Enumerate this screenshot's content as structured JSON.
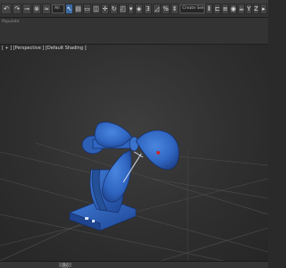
{
  "toolbar": {
    "buttons": [
      {
        "name": "undo-icon",
        "glyph": "↶"
      },
      {
        "name": "redo-icon",
        "glyph": "↷"
      },
      {
        "name": "link-icon",
        "glyph": "⊸"
      },
      {
        "name": "unlink-icon",
        "glyph": "⊗"
      },
      {
        "name": "bind-icon",
        "glyph": "≈"
      },
      {
        "name": "select-filter-icon",
        "glyph": "All"
      },
      {
        "name": "select-object-icon",
        "glyph": "↖"
      },
      {
        "name": "select-by-name-icon",
        "glyph": "▤"
      },
      {
        "name": "rect-region-icon",
        "glyph": "▭"
      },
      {
        "name": "window-crossing-icon",
        "glyph": "◫"
      },
      {
        "name": "move-icon",
        "glyph": "✛"
      },
      {
        "name": "rotate-icon",
        "glyph": "↻"
      },
      {
        "name": "scale-icon",
        "glyph": "◰"
      },
      {
        "name": "ref-coord-icon",
        "glyph": "▾"
      },
      {
        "name": "pivot-icon",
        "glyph": "◈"
      },
      {
        "name": "snap-3d-icon",
        "glyph": "3"
      },
      {
        "name": "angle-snap-icon",
        "glyph": "◿"
      },
      {
        "name": "percent-snap-icon",
        "glyph": "%"
      },
      {
        "name": "spinner-snap-icon",
        "glyph": "⇕"
      },
      {
        "name": "named-sets-icon",
        "glyph": "{}"
      },
      {
        "name": "mirror-icon",
        "glyph": "⫴"
      },
      {
        "name": "align-icon",
        "glyph": "⊏"
      },
      {
        "name": "layers-icon",
        "glyph": "≡"
      },
      {
        "name": "scene-explorer-icon",
        "glyph": "▦"
      },
      {
        "name": "curve-editor-icon",
        "glyph": "∿"
      },
      {
        "name": "schematic-icon",
        "glyph": "⧉"
      },
      {
        "name": "material-editor-icon",
        "glyph": "◉"
      },
      {
        "name": "render-setup-icon",
        "glyph": "⚙"
      },
      {
        "name": "render-frame-icon",
        "glyph": "▣"
      },
      {
        "name": "render-icon",
        "glyph": "☕"
      },
      {
        "name": "axis-y-icon",
        "glyph": "Y"
      },
      {
        "name": "axis-z-icon",
        "glyph": "Z"
      },
      {
        "name": "axis-xy-icon",
        "glyph": "≚"
      },
      {
        "name": "scroll-arrow-icon",
        "glyph": "▸"
      }
    ],
    "dropdown_label": "Create Selection Set",
    "selection_filter": "All"
  },
  "subbar": {
    "label": "Populate"
  },
  "viewport": {
    "label": "[ + ] [Perspective ] [Default Shading ]"
  },
  "timeline": {
    "slider": "0 / 100"
  },
  "colors": {
    "background": "#2f2f2f",
    "grid": "#505050",
    "model_blue": "#2f66c2",
    "model_dark": "#1d3f87",
    "selected_button": "#3d6aa3"
  }
}
